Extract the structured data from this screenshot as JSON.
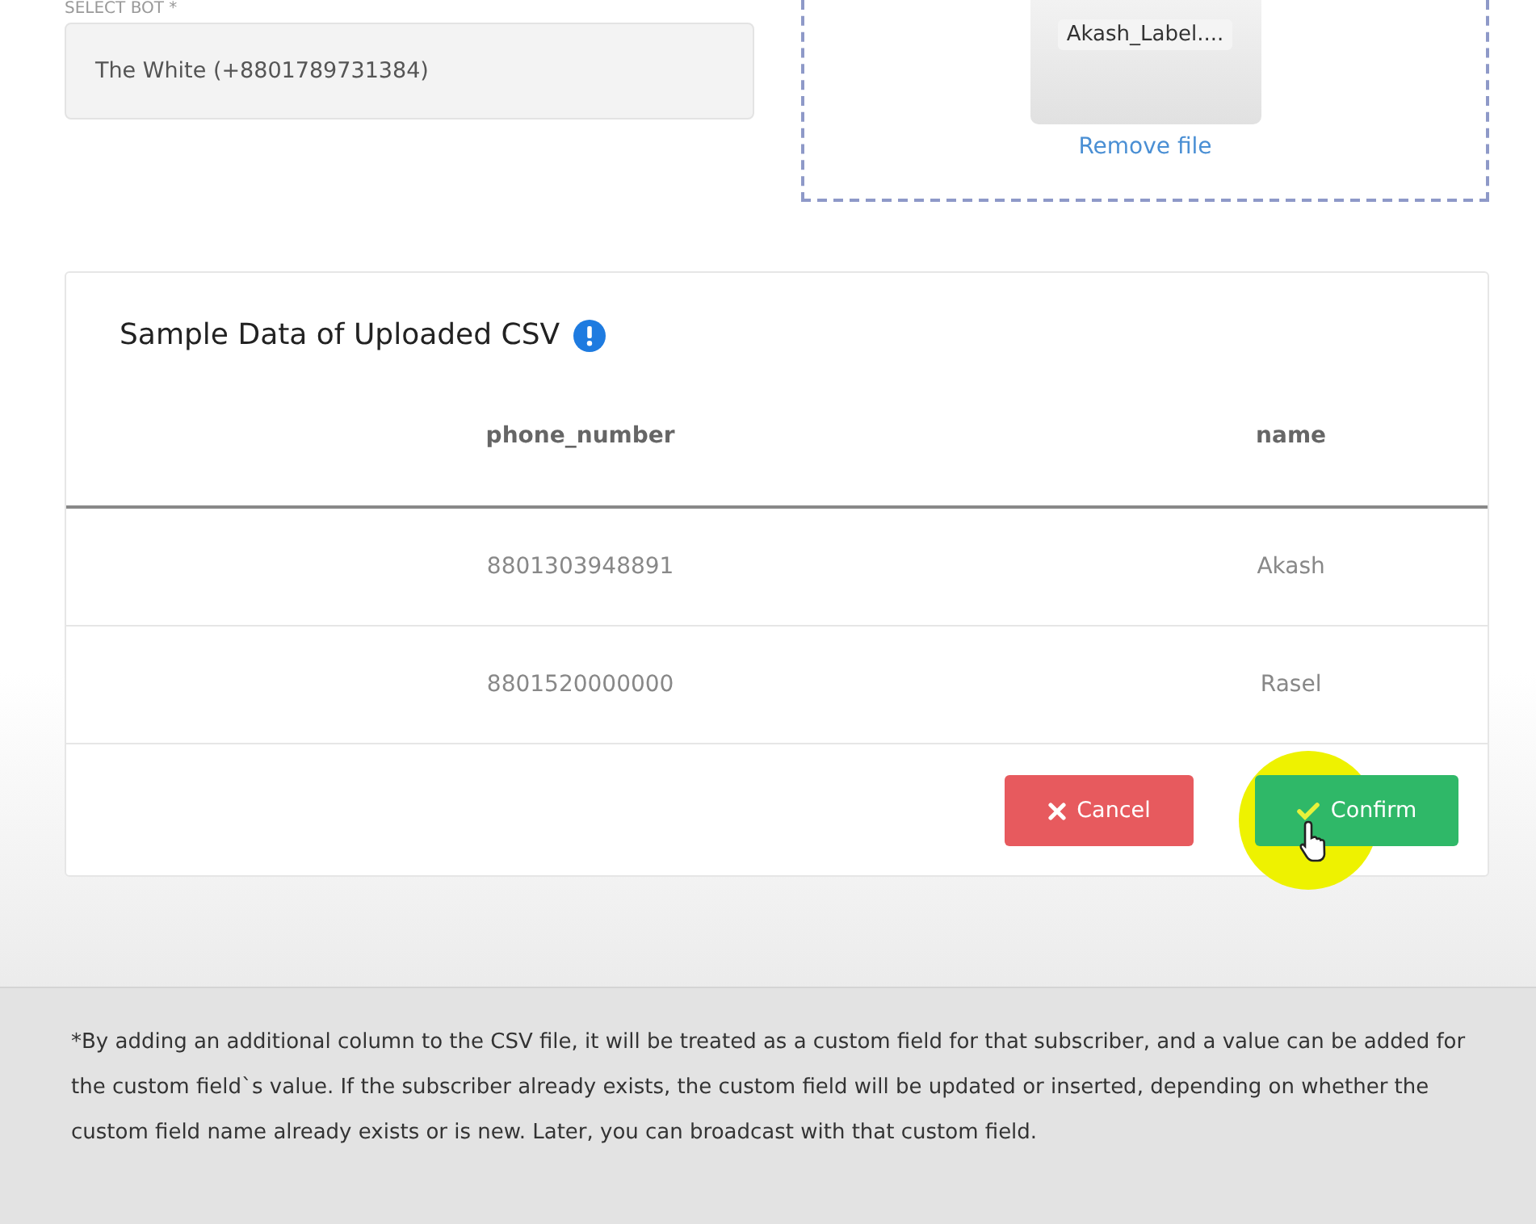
{
  "bot_select": {
    "label": "SELECT BOT *",
    "value": "The White (+8801789731384)"
  },
  "upload": {
    "file_name": "Akash_Label....",
    "remove_link": "Remove file"
  },
  "sample_card": {
    "title": "Sample Data of Uploaded CSV",
    "table": {
      "columns": [
        "phone_number",
        "name"
      ],
      "rows": [
        [
          "8801303948891",
          "Akash"
        ],
        [
          "8801520000000",
          "Rasel"
        ]
      ]
    },
    "buttons": [
      {
        "kind": "cancel",
        "label": "Cancel"
      },
      {
        "kind": "confirm",
        "label": "Confirm"
      }
    ]
  },
  "note": "*By adding an additional column to the CSV file, it will be treated as a custom field for that subscriber, and a value can be added for the custom field`s value. If the subscriber already exists, the custom field will be updated or inserted, depending on whether the custom field name already exists or is new. Later, you can broadcast with that custom field."
}
